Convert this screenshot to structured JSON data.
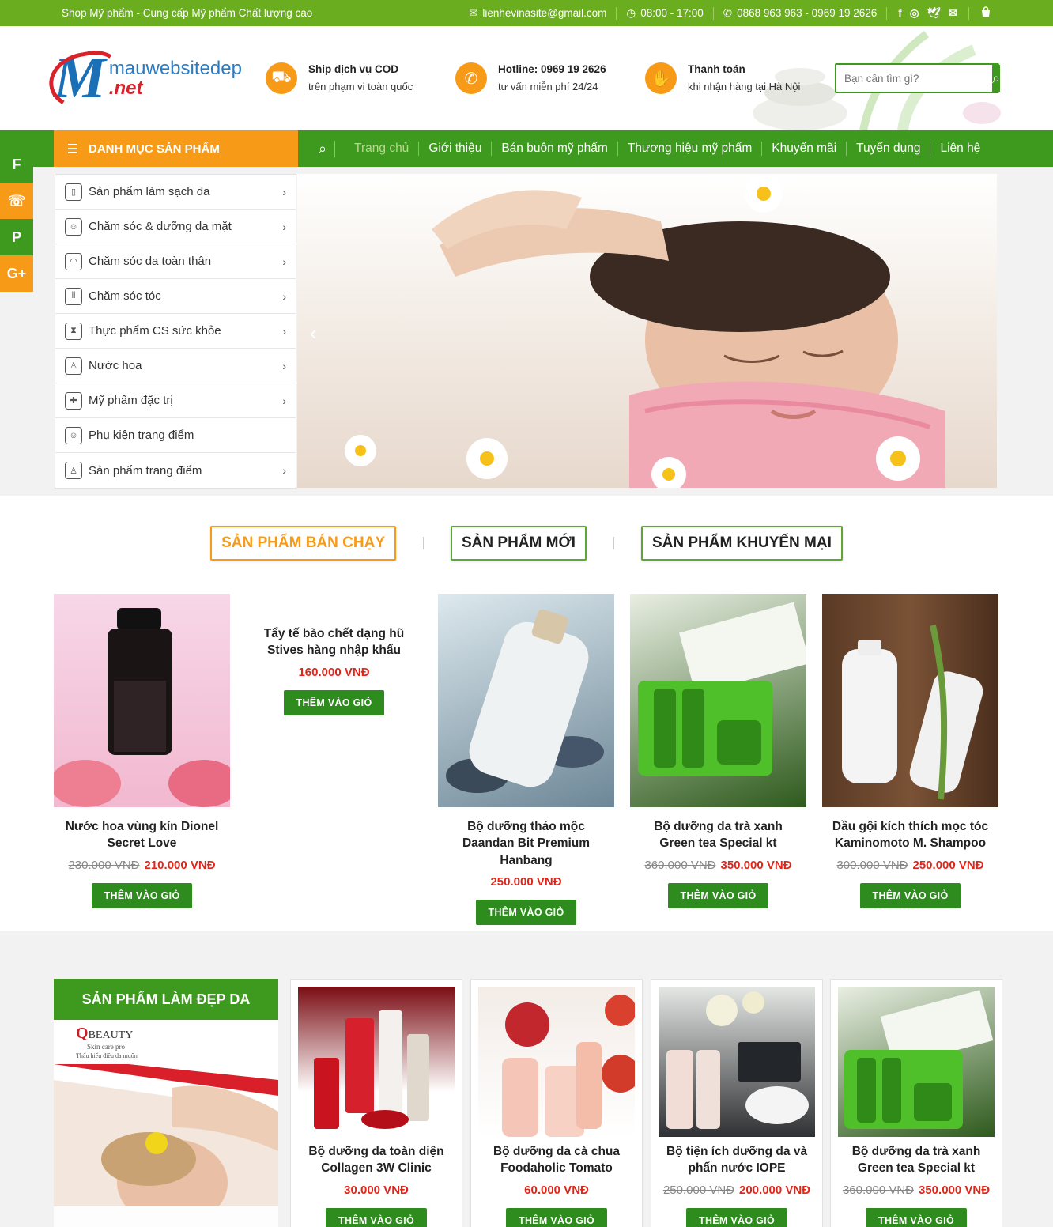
{
  "topbar": {
    "tagline": "Shop Mỹ phẩm - Cung cấp Mỹ phẩm Chất lượng cao",
    "email": "lienhevinasite@gmail.com",
    "hours": "08:00 - 17:00",
    "phones": "0868 963 963 - 0969 19 2626",
    "social_icons": [
      "facebook-icon",
      "instagram-icon",
      "twitter-icon",
      "mail-icon"
    ]
  },
  "header": {
    "logo_line1": "mauwebsitedep",
    "logo_line2": ".net",
    "features": [
      {
        "title": "Ship dịch vụ COD",
        "sub": "trên phạm vi toàn quốc",
        "icon": "truck-icon"
      },
      {
        "title": "Hotline: 0969 19 2626",
        "sub": "tư vấn miễn phí 24/24",
        "icon": "phone-icon"
      },
      {
        "title": "Thanh toán",
        "sub": "khi nhận hàng tại Hà Nội",
        "icon": "payment-icon"
      }
    ],
    "search_placeholder": "Bạn cần tìm gì?"
  },
  "nav": {
    "category_label": "DANH MỤC SẢN PHẨM",
    "items": [
      "Trang chủ",
      "Giới thiệu",
      "Bán buôn mỹ phẩm",
      "Thương hiệu mỹ phẩm",
      "Khuyến mãi",
      "Tuyển dụng",
      "Liên hệ"
    ],
    "active_index": 0
  },
  "categories": [
    {
      "label": "Sản phẩm làm sạch da",
      "has_sub": true
    },
    {
      "label": "Chăm sóc & dưỡng da mặt",
      "has_sub": true
    },
    {
      "label": "Chăm sóc da toàn thân",
      "has_sub": true
    },
    {
      "label": "Chăm sóc tóc",
      "has_sub": true
    },
    {
      "label": "Thực phẩm CS sức khỏe",
      "has_sub": true
    },
    {
      "label": "Nước hoa",
      "has_sub": true
    },
    {
      "label": "Mỹ phẩm đặc trị",
      "has_sub": true
    },
    {
      "label": "Phụ kiện trang điểm",
      "has_sub": false
    },
    {
      "label": "Sản phẩm trang điểm",
      "has_sub": true
    }
  ],
  "float_social": [
    "F",
    "☏",
    "P",
    "G+"
  ],
  "tabs": [
    "SẢN PHẨM BÁN CHẠY",
    "SẢN PHẨM MỚI",
    "SẢN PHẨM KHUYẾN MẠI"
  ],
  "featured_products": [
    {
      "name": "Nước hoa vùng kín Dionel Secret Love",
      "old_price": "230.000 VNĐ",
      "price": "210.000 VNĐ",
      "button": "THÊM VÀO GIỎ"
    },
    {
      "name": "Tẩy tế bào chết dạng hũ Stives hàng nhập khẩu",
      "old_price": "",
      "price": "160.000 VNĐ",
      "button": "THÊM VÀO GIỎ"
    },
    {
      "name": "Bộ dưỡng thảo mộc Daandan Bit Premium Hanbang",
      "old_price": "",
      "price": "250.000 VNĐ",
      "button": "THÊM VÀO GIỎ"
    },
    {
      "name": "Bộ dưỡng da trà xanh Green tea Special kt",
      "old_price": "360.000 VNĐ",
      "price": "350.000 VNĐ",
      "button": "THÊM VÀO GIỎ"
    },
    {
      "name": "Dầu gội kích thích mọc tóc Kaminomoto M. Shampoo",
      "old_price": "300.000 VNĐ",
      "price": "250.000 VNĐ",
      "button": "THÊM VÀO GIỎ"
    }
  ],
  "section2": {
    "title": "SẢN PHẨM LÀM ĐẸP DA",
    "brand_name": "BEAUTY",
    "brand_tag": "Skin care pro",
    "brand_slogan": "Thấu hiểu điều da muốn",
    "products": [
      {
        "name": "Bộ dưỡng da toàn diện Collagen 3W Clinic",
        "old_price": "",
        "price": "30.000 VNĐ",
        "button": "THÊM VÀO GIỎ"
      },
      {
        "name": "Bộ dưỡng da cà chua Foodaholic Tomato",
        "old_price": "",
        "price": "60.000 VNĐ",
        "button": "THÊM VÀO GIỎ"
      },
      {
        "name": "Bộ tiện ích dưỡng da và phấn nước IOPE",
        "old_price": "250.000 VNĐ",
        "price": "200.000 VNĐ",
        "button": "THÊM VÀO GIỎ"
      },
      {
        "name": "Bộ dưỡng da trà xanh Green tea Special kt",
        "old_price": "360.000 VNĐ",
        "price": "350.000 VNĐ",
        "button": "THÊM VÀO GIỎ"
      }
    ]
  },
  "colors": {
    "green": "#6aae1f",
    "dark_green": "#3e9a1f",
    "orange": "#f79a17",
    "price_red": "#e0251a"
  }
}
